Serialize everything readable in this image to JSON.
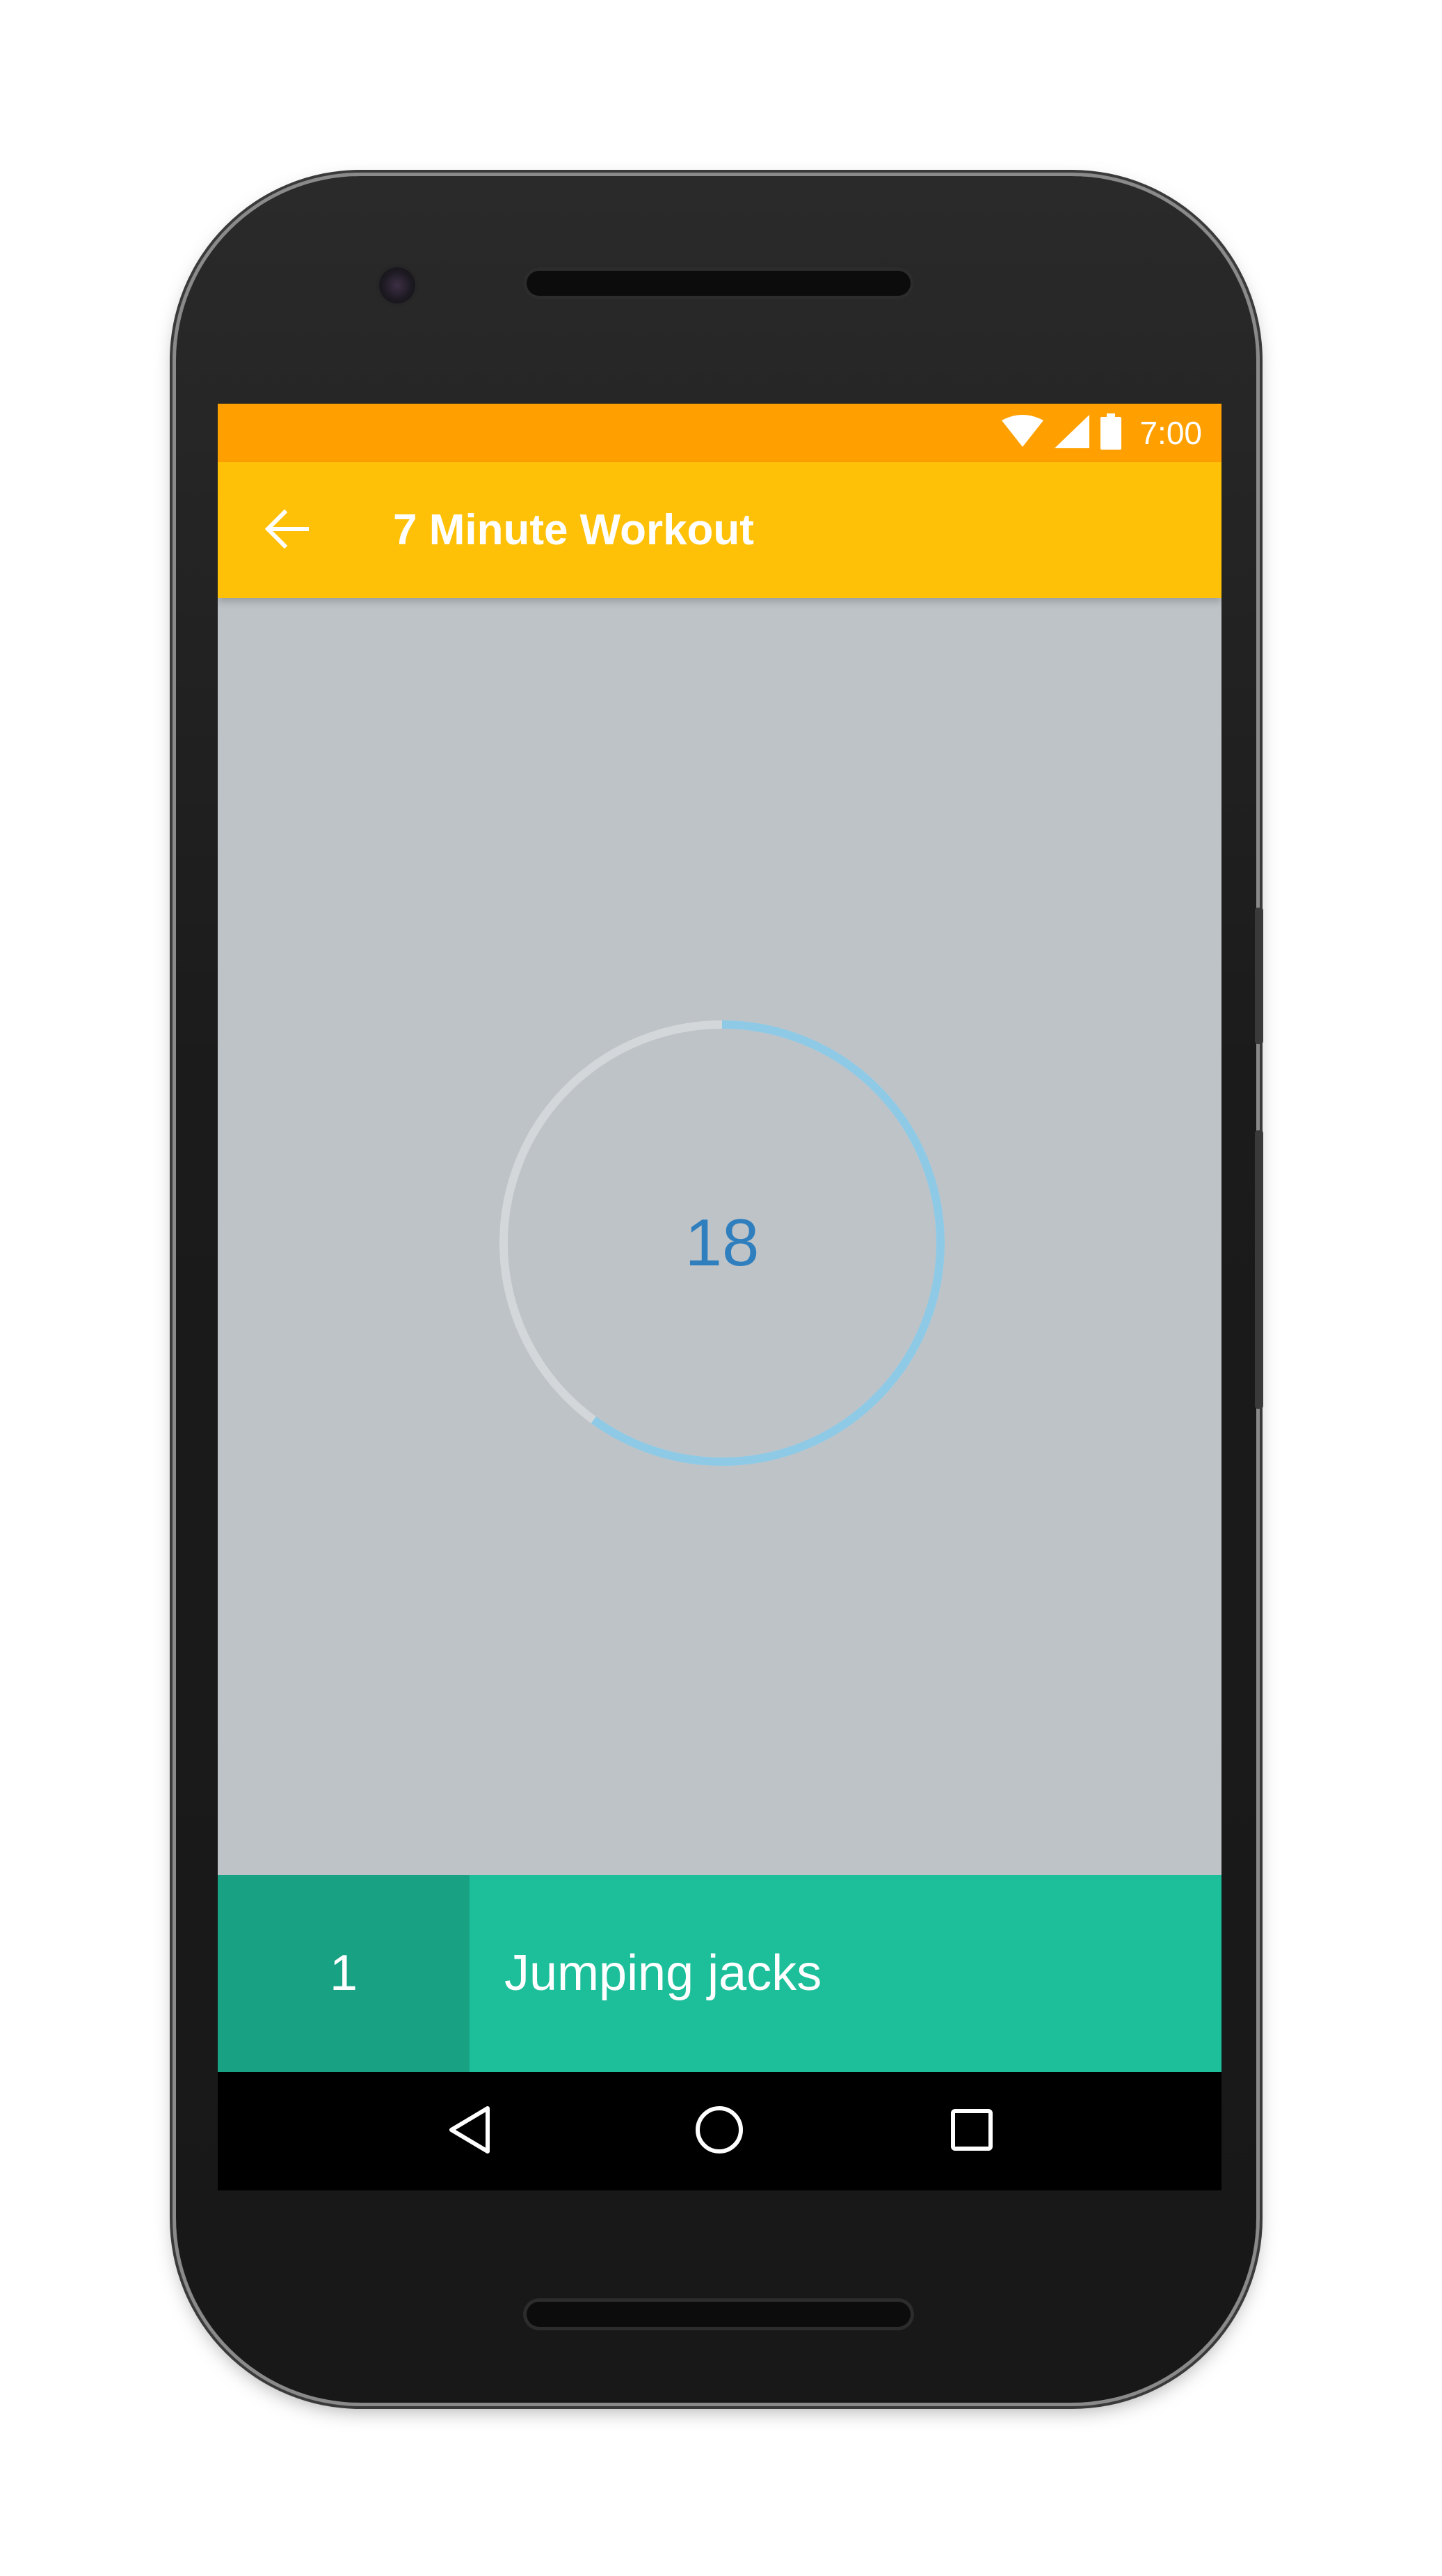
{
  "status_bar": {
    "time": "7:00",
    "icons": [
      "wifi-icon",
      "signal-icon",
      "battery-icon"
    ],
    "color": "#ffa000"
  },
  "app_bar": {
    "back_icon": "arrow-back-icon",
    "title": "7 Minute Workout",
    "color": "#ffc107"
  },
  "timer": {
    "value": "18",
    "progress_fraction": 0.6,
    "track_color": "#d3d7da",
    "progress_color": "#8ecae6",
    "text_color": "#2f7fbf"
  },
  "exercise": {
    "number": "1",
    "name": "Jumping jacks",
    "bar_color": "#1dbf9b",
    "number_box_color": "#18a283"
  },
  "nav_bar": {
    "buttons": [
      "back-triangle-icon",
      "home-circle-icon",
      "recents-square-icon"
    ]
  }
}
